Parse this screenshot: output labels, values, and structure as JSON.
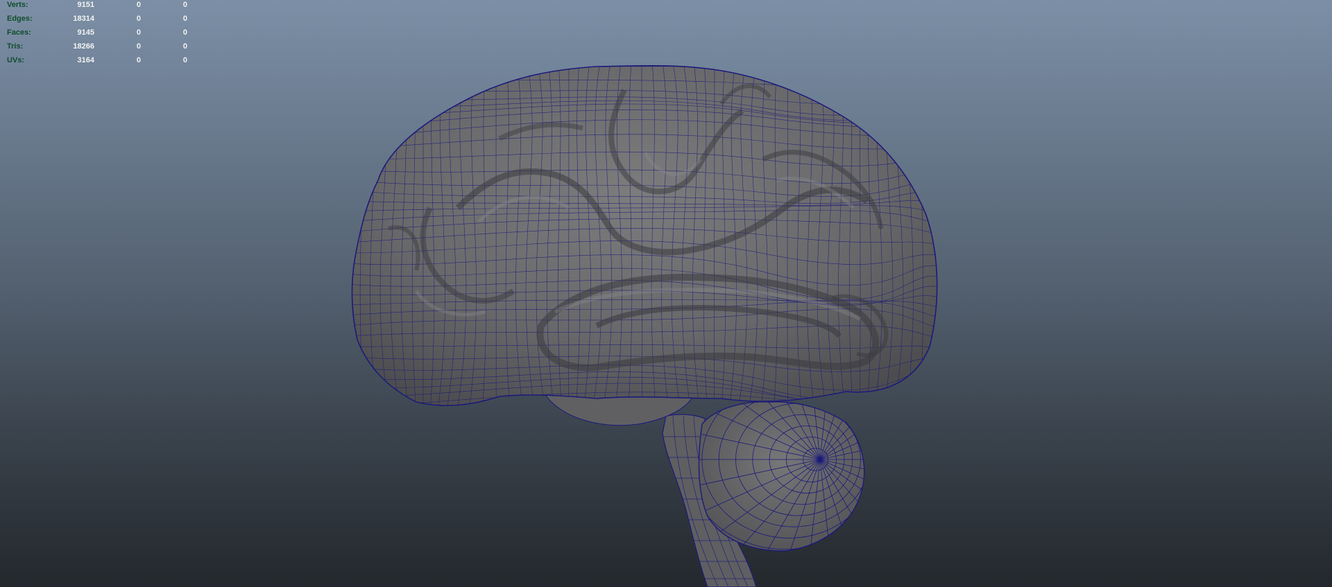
{
  "hud": {
    "rows": [
      {
        "label": "Verts:",
        "total": "9151",
        "selected": "0",
        "component": "0"
      },
      {
        "label": "Edges:",
        "total": "18314",
        "selected": "0",
        "component": "0"
      },
      {
        "label": "Faces:",
        "total": "9145",
        "selected": "0",
        "component": "0"
      },
      {
        "label": "Tris:",
        "total": "18266",
        "selected": "0",
        "component": "0"
      },
      {
        "label": "UVs:",
        "total": "3164",
        "selected": "0",
        "component": "0"
      }
    ]
  },
  "viewport": {
    "gradient_top": "#7c8fa6",
    "gradient_bottom": "#24282d",
    "wireframe_color": "#1c1a7a",
    "surface_color": "#6f6f70"
  }
}
